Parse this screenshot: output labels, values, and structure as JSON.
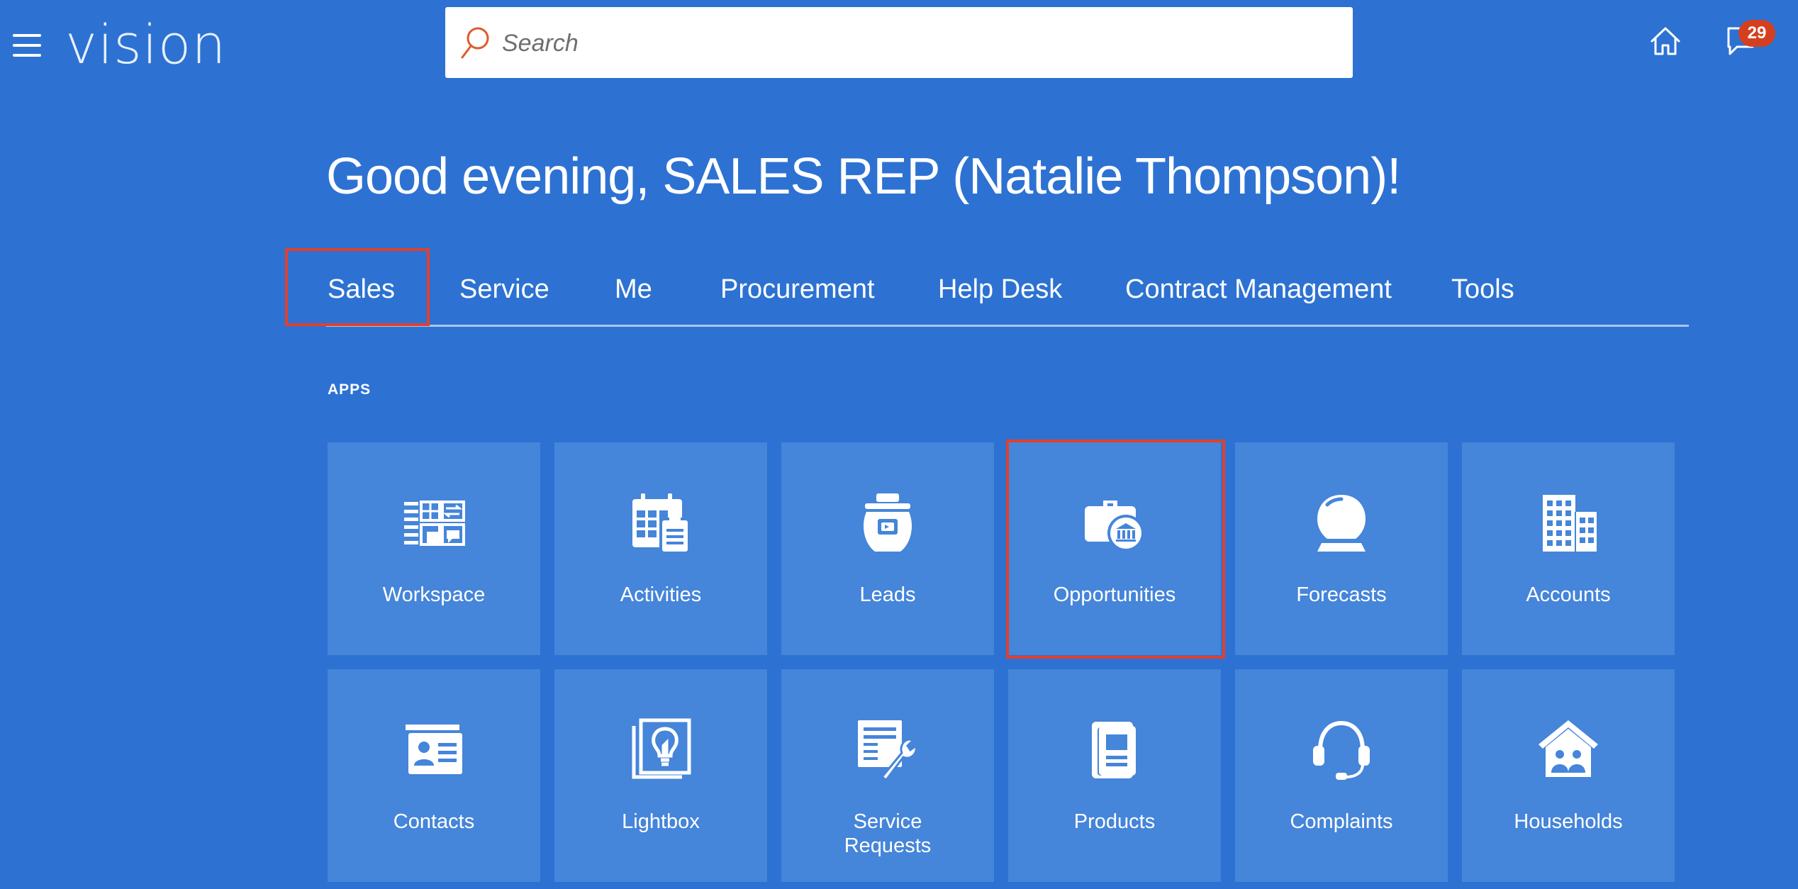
{
  "header": {
    "logo": "vision",
    "menu_icon": "hamburger-menu-icon",
    "search": {
      "placeholder": "Search",
      "icon": "search-icon"
    },
    "home_icon": "home-icon",
    "notifications": {
      "icon": "notifications-icon",
      "count": "29"
    }
  },
  "greeting": "Good evening, SALES REP (Natalie Thompson)!",
  "tabs": [
    {
      "label": "Sales",
      "active": true
    },
    {
      "label": "Service"
    },
    {
      "label": "Me"
    },
    {
      "label": "Procurement"
    },
    {
      "label": "Help Desk"
    },
    {
      "label": "Contract Management"
    },
    {
      "label": "Tools"
    }
  ],
  "apps": {
    "section_label": "APPS",
    "tiles": [
      {
        "label": "Workspace",
        "icon": "workspace-icon"
      },
      {
        "label": "Activities",
        "icon": "calendar-icon"
      },
      {
        "label": "Leads",
        "icon": "leads-icon"
      },
      {
        "label": "Opportunities",
        "icon": "briefcase-icon"
      },
      {
        "label": "Forecasts",
        "icon": "crystal-ball-icon"
      },
      {
        "label": "Accounts",
        "icon": "building-icon"
      },
      {
        "label": "Contacts",
        "icon": "contact-card-icon"
      },
      {
        "label": "Lightbox",
        "icon": "lightbulb-icon"
      },
      {
        "label": "Service Requests",
        "label_line1": "Service",
        "label_line2": "Requests",
        "icon": "wrench-form-icon"
      },
      {
        "label": "Products",
        "icon": "product-book-icon"
      },
      {
        "label": "Complaints",
        "icon": "headset-icon"
      },
      {
        "label": "Households",
        "icon": "household-icon"
      }
    ]
  },
  "colors": {
    "background": "#2d72d2",
    "tile": "#4585da",
    "highlight": "#e0402e",
    "badge": "#d4401f",
    "search_icon": "#e05a2b"
  }
}
